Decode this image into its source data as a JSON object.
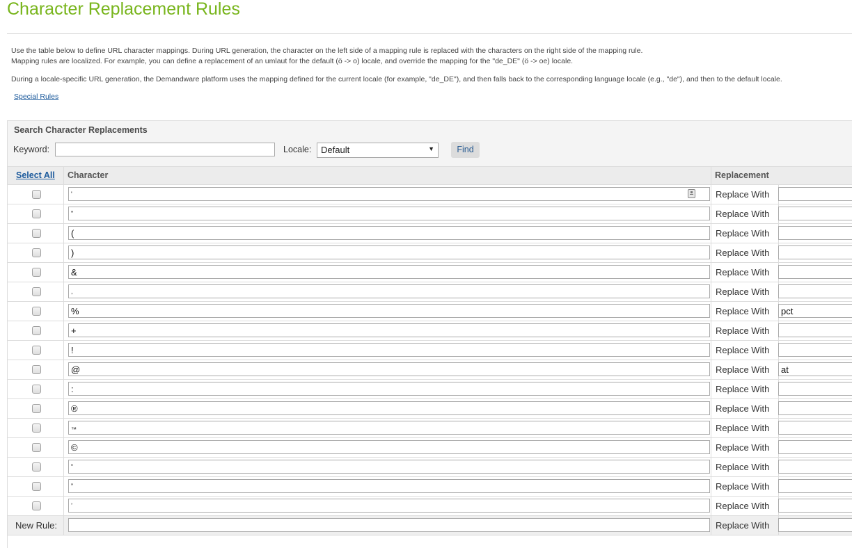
{
  "page": {
    "title": "Character Replacement Rules",
    "intro_line1": "Use the table below to define URL character mappings. During URL generation, the character on the left side of a mapping rule is replaced with the characters on the right side of the mapping rule.",
    "intro_line2": "Mapping rules are localized. For example, you can define a replacement of an umlaut for the default (ö -> o) locale, and override the mapping for the \"de_DE\" (ö -> oe) locale.",
    "intro_line3": "During a locale-specific URL generation, the Demandware platform uses the mapping defined for the current locale (for example, \"de_DE\"), and then falls back to the corresponding language locale (e.g., \"de\"), and then to the default locale.",
    "special_rules_link": "Special Rules"
  },
  "search": {
    "title": "Search Character Replacements",
    "keyword_label": "Keyword:",
    "keyword_value": "",
    "locale_label": "Locale:",
    "locale_selected": "Default",
    "find_label": "Find"
  },
  "table": {
    "select_all_label": "Select All",
    "character_header": "Character",
    "replacement_header": "Replacement",
    "replace_with_label": "Replace With",
    "new_rule_label": "New Rule:",
    "rows": [
      {
        "character": "'",
        "replacement": "",
        "checked": false
      },
      {
        "character": "\"",
        "replacement": "",
        "checked": false
      },
      {
        "character": "(",
        "replacement": "",
        "checked": false
      },
      {
        "character": ")",
        "replacement": "",
        "checked": false
      },
      {
        "character": "&",
        "replacement": "",
        "checked": false
      },
      {
        "character": ",",
        "replacement": "",
        "checked": false
      },
      {
        "character": "%",
        "replacement": "pct",
        "checked": false
      },
      {
        "character": "+",
        "replacement": "",
        "checked": false
      },
      {
        "character": "!",
        "replacement": "",
        "checked": false
      },
      {
        "character": "@",
        "replacement": "at",
        "checked": false
      },
      {
        "character": ":",
        "replacement": "",
        "checked": false
      },
      {
        "character": "®",
        "replacement": "",
        "checked": false
      },
      {
        "character": "™",
        "replacement": "",
        "checked": false
      },
      {
        "character": "©",
        "replacement": "",
        "checked": false
      },
      {
        "character": "“",
        "replacement": "",
        "checked": false
      },
      {
        "character": "”",
        "replacement": "",
        "checked": false
      },
      {
        "character": "’",
        "replacement": "",
        "checked": false
      }
    ],
    "new_rule": {
      "character": "",
      "replacement": ""
    }
  },
  "colors": {
    "title_green": "#78b51c",
    "link_blue": "#1c5a9c"
  }
}
